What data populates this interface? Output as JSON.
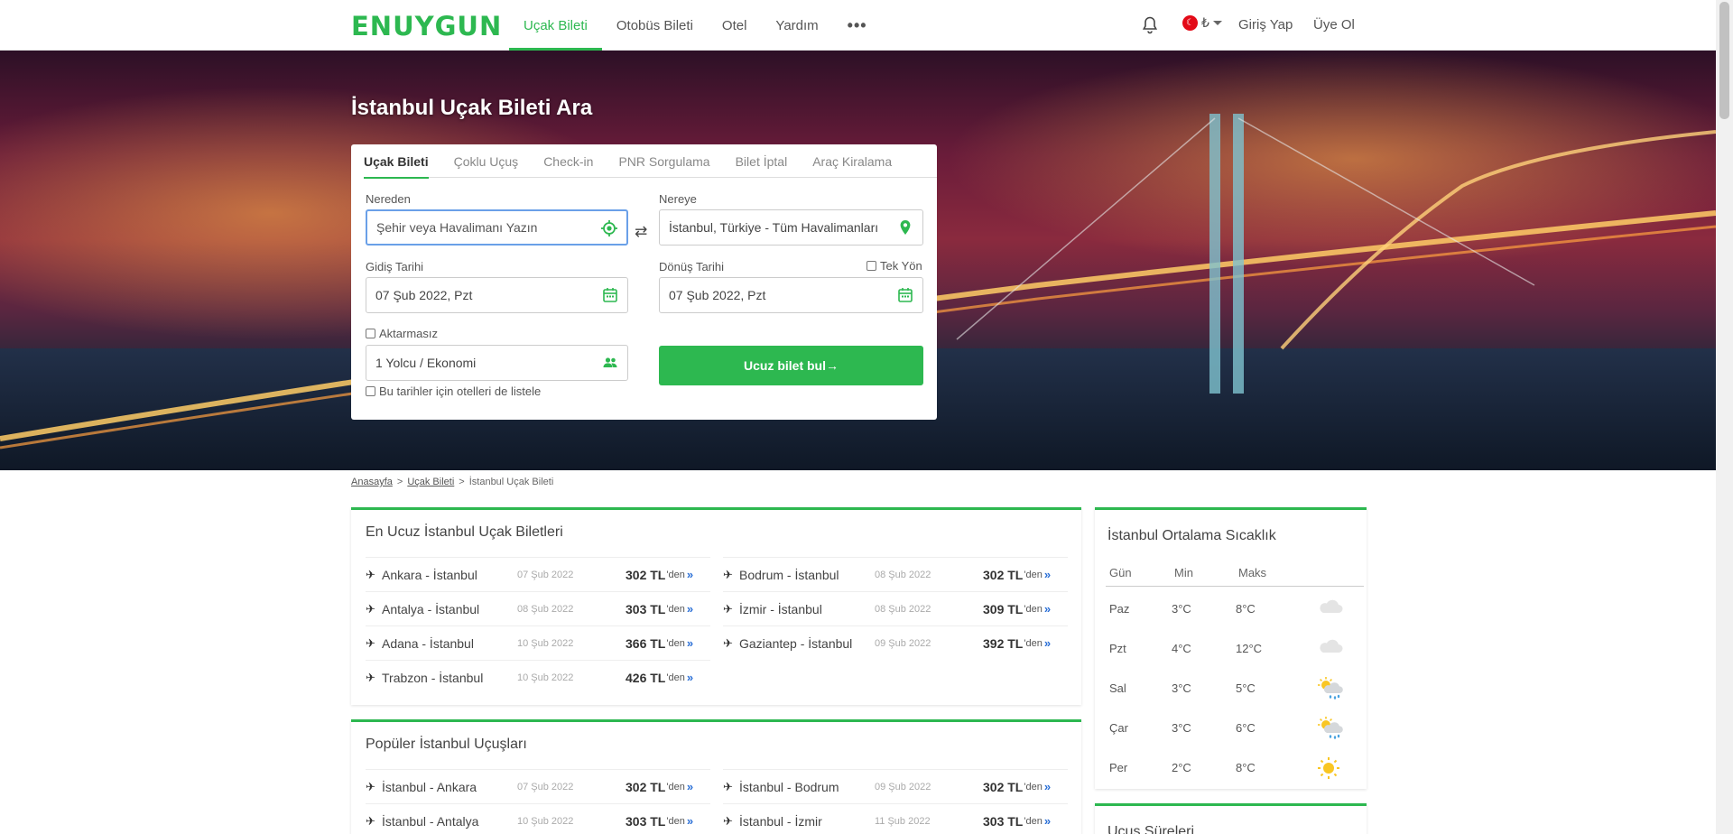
{
  "brand": "ENUYGUN",
  "nav": {
    "items": [
      "Uçak Bileti",
      "Otobüs Bileti",
      "Otel",
      "Yardım"
    ],
    "more": "•••",
    "currency": "₺",
    "login": "Giriş Yap",
    "signup": "Üye Ol"
  },
  "hero": {
    "title": "İstanbul Uçak Bileti Ara"
  },
  "search": {
    "tabs": [
      "Uçak Bileti",
      "Çoklu Uçuş",
      "Check-in",
      "PNR Sorgulama",
      "Bilet İptal",
      "Araç Kiralama"
    ],
    "from_label": "Nereden",
    "from_placeholder": "Şehir veya Havalimanı Yazın",
    "to_label": "Nereye",
    "to_value": "İstanbul, Türkiye - Tüm Havalimanları",
    "depart_label": "Gidiş Tarihi",
    "depart_value": "07 Şub 2022, Pzt",
    "return_label": "Dönüş Tarihi",
    "return_value": "07 Şub 2022, Pzt",
    "oneway_label": "Tek Yön",
    "nonstop_label": "Aktarmasız",
    "passengers_value": "1 Yolcu / Ekonomi",
    "hotels_label": "Bu tarihler için otelleri de listele",
    "submit_label": "Ucuz bilet bul",
    "submit_arrow": "→"
  },
  "breadcrumb": {
    "home": "Anasayfa",
    "sep": ">",
    "flights": "Uçak Bileti",
    "current": "İstanbul Uçak Bileti"
  },
  "cheapest": {
    "title": "En Ucuz İstanbul Uçak Biletleri",
    "suffix": "'den",
    "arrow": "»",
    "plane": "✈",
    "left": [
      {
        "route": "Ankara - İstanbul",
        "date": "07 Şub 2022",
        "price": "302 TL"
      },
      {
        "route": "Antalya - İstanbul",
        "date": "08 Şub 2022",
        "price": "303 TL"
      },
      {
        "route": "Adana - İstanbul",
        "date": "10 Şub 2022",
        "price": "366 TL"
      },
      {
        "route": "Trabzon - İstanbul",
        "date": "10 Şub 2022",
        "price": "426 TL"
      }
    ],
    "right": [
      {
        "route": "Bodrum - İstanbul",
        "date": "08 Şub 2022",
        "price": "302 TL"
      },
      {
        "route": "İzmir - İstanbul",
        "date": "08 Şub 2022",
        "price": "309 TL"
      },
      {
        "route": "Gaziantep - İstanbul",
        "date": "09 Şub 2022",
        "price": "392 TL"
      }
    ]
  },
  "popular": {
    "title": "Popüler İstanbul Uçuşları",
    "left": [
      {
        "route": "İstanbul - Ankara",
        "date": "07 Şub 2022",
        "price": "302 TL"
      },
      {
        "route": "İstanbul - Antalya",
        "date": "10 Şub 2022",
        "price": "303 TL"
      }
    ],
    "right": [
      {
        "route": "İstanbul - Bodrum",
        "date": "09 Şub 2022",
        "price": "302 TL"
      },
      {
        "route": "İstanbul - İzmir",
        "date": "11 Şub 2022",
        "price": "303 TL"
      }
    ]
  },
  "weather": {
    "title": "İstanbul Ortalama Sıcaklık",
    "headers": [
      "Gün",
      "Min",
      "Maks"
    ],
    "rows": [
      {
        "day": "Paz",
        "min": "3°C",
        "max": "8°C",
        "icon": "cloud-icon"
      },
      {
        "day": "Pzt",
        "min": "4°C",
        "max": "12°C",
        "icon": "cloud-icon"
      },
      {
        "day": "Sal",
        "min": "3°C",
        "max": "5°C",
        "icon": "sun-rain-icon"
      },
      {
        "day": "Çar",
        "min": "3°C",
        "max": "6°C",
        "icon": "sun-rain-icon"
      },
      {
        "day": "Per",
        "min": "2°C",
        "max": "8°C",
        "icon": "sun-icon"
      }
    ]
  },
  "durations": {
    "title": "Uçuş Süreleri"
  },
  "colors": {
    "brand": "#2db850",
    "link_arrow": "#2a6fd6"
  }
}
